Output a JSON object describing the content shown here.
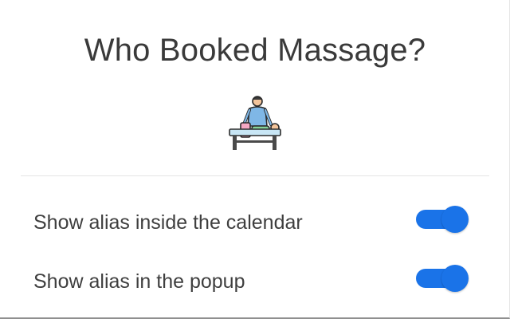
{
  "header": {
    "title": "Who Booked Massage?",
    "logo_icon": "massage-therapist-icon"
  },
  "settings": {
    "items": [
      {
        "label": "Show alias inside the calendar",
        "enabled": true
      },
      {
        "label": "Show alias in the popup",
        "enabled": true
      }
    ]
  },
  "colors": {
    "accent": "#1a73e8",
    "title_text": "#3a3a3a",
    "divider": "#e4e4e4"
  }
}
